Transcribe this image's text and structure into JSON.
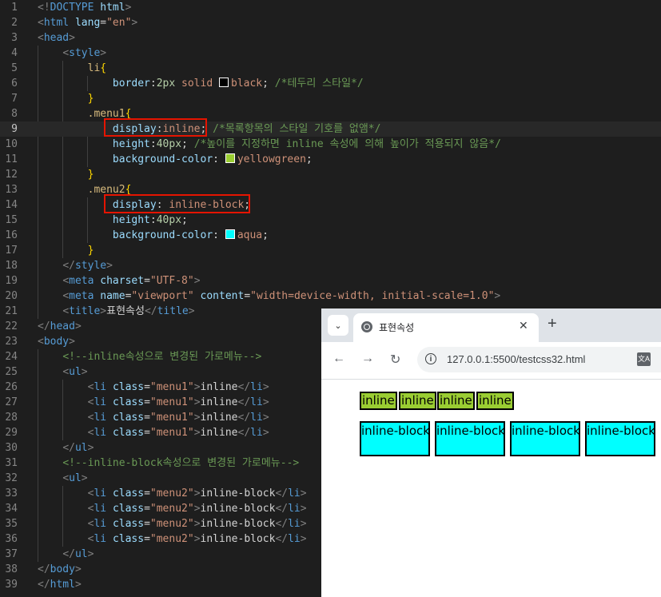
{
  "editor": {
    "lines": [
      {
        "n": "1",
        "segs": [
          [
            "t",
            "<!"
          ],
          [
            "tag",
            "DOCTYPE"
          ],
          [
            "txt",
            " "
          ],
          [
            "attr",
            "html"
          ],
          [
            "t",
            ">"
          ]
        ]
      },
      {
        "n": "2",
        "segs": [
          [
            "t",
            "<"
          ],
          [
            "tag",
            "html"
          ],
          [
            "txt",
            " "
          ],
          [
            "attr",
            "lang"
          ],
          [
            "txt",
            "="
          ],
          [
            "str",
            "\"en\""
          ],
          [
            "t",
            ">"
          ]
        ]
      },
      {
        "n": "3",
        "segs": [
          [
            "t",
            "<"
          ],
          [
            "tag",
            "head"
          ],
          [
            "t",
            ">"
          ]
        ]
      },
      {
        "n": "4",
        "segs": [
          [
            "txt",
            "    "
          ],
          [
            "t",
            "<"
          ],
          [
            "tag",
            "style"
          ],
          [
            "t",
            ">"
          ]
        ]
      },
      {
        "n": "5",
        "segs": [
          [
            "txt",
            "        "
          ],
          [
            "sel",
            "li"
          ],
          [
            "brace",
            "{"
          ]
        ]
      },
      {
        "n": "6",
        "segs": [
          [
            "txt",
            "            "
          ],
          [
            "prop",
            "border"
          ],
          [
            "txt",
            ":"
          ],
          [
            "num",
            "2px"
          ],
          [
            "txt",
            " "
          ],
          [
            "val",
            "solid"
          ],
          [
            "txt",
            " "
          ],
          [
            "swatch",
            "#000000"
          ],
          [
            "val",
            "black"
          ],
          [
            "txt",
            "; "
          ],
          [
            "cmt",
            "/*테두리 스타일*/"
          ]
        ]
      },
      {
        "n": "7",
        "segs": [
          [
            "txt",
            "        "
          ],
          [
            "brace",
            "}"
          ]
        ]
      },
      {
        "n": "8",
        "segs": [
          [
            "txt",
            "        "
          ],
          [
            "sel",
            ".menu1"
          ],
          [
            "brace",
            "{"
          ]
        ]
      },
      {
        "n": "9",
        "segs": [
          [
            "txt",
            "            "
          ],
          [
            "prop",
            "display"
          ],
          [
            "txt",
            ":"
          ],
          [
            "val",
            "inline"
          ],
          [
            "txt",
            "; "
          ],
          [
            "cmt",
            "/*목록항목의 스타일 기호를 없앰*/"
          ]
        ]
      },
      {
        "n": "10",
        "segs": [
          [
            "txt",
            "            "
          ],
          [
            "prop",
            "height"
          ],
          [
            "txt",
            ":"
          ],
          [
            "num",
            "40px"
          ],
          [
            "txt",
            "; "
          ],
          [
            "cmt",
            "/*높이를 지정하면 inline 속성에 의해 높이가 적용되지 않음*/"
          ]
        ]
      },
      {
        "n": "11",
        "segs": [
          [
            "txt",
            "            "
          ],
          [
            "prop",
            "background-color"
          ],
          [
            "txt",
            ": "
          ],
          [
            "swatch",
            "#9acd32"
          ],
          [
            "val",
            "yellowgreen"
          ],
          [
            "txt",
            ";"
          ]
        ]
      },
      {
        "n": "12",
        "segs": [
          [
            "txt",
            "        "
          ],
          [
            "brace",
            "}"
          ]
        ]
      },
      {
        "n": "13",
        "segs": [
          [
            "txt",
            "        "
          ],
          [
            "sel",
            ".menu2"
          ],
          [
            "brace",
            "{"
          ]
        ]
      },
      {
        "n": "14",
        "segs": [
          [
            "txt",
            "            "
          ],
          [
            "prop",
            "display"
          ],
          [
            "txt",
            ": "
          ],
          [
            "val",
            "inline-block"
          ],
          [
            "txt",
            ";"
          ]
        ]
      },
      {
        "n": "15",
        "segs": [
          [
            "txt",
            "            "
          ],
          [
            "prop",
            "height"
          ],
          [
            "txt",
            ":"
          ],
          [
            "num",
            "40px"
          ],
          [
            "txt",
            ";"
          ]
        ]
      },
      {
        "n": "16",
        "segs": [
          [
            "txt",
            "            "
          ],
          [
            "prop",
            "background-color"
          ],
          [
            "txt",
            ": "
          ],
          [
            "swatch",
            "#00ffff"
          ],
          [
            "val",
            "aqua"
          ],
          [
            "txt",
            ";"
          ]
        ]
      },
      {
        "n": "17",
        "segs": [
          [
            "txt",
            "        "
          ],
          [
            "brace",
            "}"
          ]
        ]
      },
      {
        "n": "18",
        "segs": [
          [
            "txt",
            "    "
          ],
          [
            "t",
            "</"
          ],
          [
            "tag",
            "style"
          ],
          [
            "t",
            ">"
          ]
        ]
      },
      {
        "n": "19",
        "segs": [
          [
            "txt",
            "    "
          ],
          [
            "t",
            "<"
          ],
          [
            "tag",
            "meta"
          ],
          [
            "txt",
            " "
          ],
          [
            "attr",
            "charset"
          ],
          [
            "txt",
            "="
          ],
          [
            "str",
            "\"UTF-8\""
          ],
          [
            "t",
            ">"
          ]
        ]
      },
      {
        "n": "20",
        "segs": [
          [
            "txt",
            "    "
          ],
          [
            "t",
            "<"
          ],
          [
            "tag",
            "meta"
          ],
          [
            "txt",
            " "
          ],
          [
            "attr",
            "name"
          ],
          [
            "txt",
            "="
          ],
          [
            "str",
            "\"viewport\""
          ],
          [
            "txt",
            " "
          ],
          [
            "attr",
            "content"
          ],
          [
            "txt",
            "="
          ],
          [
            "str",
            "\"width=device-width, initial-scale=1.0\""
          ],
          [
            "t",
            ">"
          ]
        ]
      },
      {
        "n": "21",
        "segs": [
          [
            "txt",
            "    "
          ],
          [
            "t",
            "<"
          ],
          [
            "tag",
            "title"
          ],
          [
            "t",
            ">"
          ],
          [
            "txt",
            "표현속성"
          ],
          [
            "t",
            "</"
          ],
          [
            "tag",
            "title"
          ],
          [
            "t",
            ">"
          ]
        ]
      },
      {
        "n": "22",
        "segs": [
          [
            "t",
            "</"
          ],
          [
            "tag",
            "head"
          ],
          [
            "t",
            ">"
          ]
        ]
      },
      {
        "n": "23",
        "segs": [
          [
            "t",
            "<"
          ],
          [
            "tag",
            "body"
          ],
          [
            "t",
            ">"
          ]
        ]
      },
      {
        "n": "24",
        "segs": [
          [
            "txt",
            "    "
          ],
          [
            "cmt",
            "<!--inline속성으로 변경된 가로메뉴-->"
          ]
        ]
      },
      {
        "n": "25",
        "segs": [
          [
            "txt",
            "    "
          ],
          [
            "t",
            "<"
          ],
          [
            "tag",
            "ul"
          ],
          [
            "t",
            ">"
          ]
        ]
      },
      {
        "n": "26",
        "segs": [
          [
            "txt",
            "        "
          ],
          [
            "t",
            "<"
          ],
          [
            "tag",
            "li"
          ],
          [
            "txt",
            " "
          ],
          [
            "attr",
            "class"
          ],
          [
            "txt",
            "="
          ],
          [
            "str",
            "\"menu1\""
          ],
          [
            "t",
            ">"
          ],
          [
            "txt",
            "inline"
          ],
          [
            "t",
            "</"
          ],
          [
            "tag",
            "li"
          ],
          [
            "t",
            ">"
          ]
        ]
      },
      {
        "n": "27",
        "segs": [
          [
            "txt",
            "        "
          ],
          [
            "t",
            "<"
          ],
          [
            "tag",
            "li"
          ],
          [
            "txt",
            " "
          ],
          [
            "attr",
            "class"
          ],
          [
            "txt",
            "="
          ],
          [
            "str",
            "\"menu1\""
          ],
          [
            "t",
            ">"
          ],
          [
            "txt",
            "inline"
          ],
          [
            "t",
            "</"
          ],
          [
            "tag",
            "li"
          ],
          [
            "t",
            ">"
          ]
        ]
      },
      {
        "n": "28",
        "segs": [
          [
            "txt",
            "        "
          ],
          [
            "t",
            "<"
          ],
          [
            "tag",
            "li"
          ],
          [
            "txt",
            " "
          ],
          [
            "attr",
            "class"
          ],
          [
            "txt",
            "="
          ],
          [
            "str",
            "\"menu1\""
          ],
          [
            "t",
            ">"
          ],
          [
            "txt",
            "inline"
          ],
          [
            "t",
            "</"
          ],
          [
            "tag",
            "li"
          ],
          [
            "t",
            ">"
          ]
        ]
      },
      {
        "n": "29",
        "segs": [
          [
            "txt",
            "        "
          ],
          [
            "t",
            "<"
          ],
          [
            "tag",
            "li"
          ],
          [
            "txt",
            " "
          ],
          [
            "attr",
            "class"
          ],
          [
            "txt",
            "="
          ],
          [
            "str",
            "\"menu1\""
          ],
          [
            "t",
            ">"
          ],
          [
            "txt",
            "inline"
          ],
          [
            "t",
            "</"
          ],
          [
            "tag",
            "li"
          ],
          [
            "t",
            ">"
          ]
        ]
      },
      {
        "n": "30",
        "segs": [
          [
            "txt",
            "    "
          ],
          [
            "t",
            "</"
          ],
          [
            "tag",
            "ul"
          ],
          [
            "t",
            ">"
          ]
        ]
      },
      {
        "n": "31",
        "segs": [
          [
            "txt",
            "    "
          ],
          [
            "cmt",
            "<!--inline-block속성으로 변경된 가로메뉴-->"
          ]
        ]
      },
      {
        "n": "32",
        "segs": [
          [
            "txt",
            "    "
          ],
          [
            "t",
            "<"
          ],
          [
            "tag",
            "ul"
          ],
          [
            "t",
            ">"
          ]
        ]
      },
      {
        "n": "33",
        "segs": [
          [
            "txt",
            "        "
          ],
          [
            "t",
            "<"
          ],
          [
            "tag",
            "li"
          ],
          [
            "txt",
            " "
          ],
          [
            "attr",
            "class"
          ],
          [
            "txt",
            "="
          ],
          [
            "str",
            "\"menu2\""
          ],
          [
            "t",
            ">"
          ],
          [
            "txt",
            "inline-block"
          ],
          [
            "t",
            "</"
          ],
          [
            "tag",
            "li"
          ],
          [
            "t",
            ">"
          ]
        ]
      },
      {
        "n": "34",
        "segs": [
          [
            "txt",
            "        "
          ],
          [
            "t",
            "<"
          ],
          [
            "tag",
            "li"
          ],
          [
            "txt",
            " "
          ],
          [
            "attr",
            "class"
          ],
          [
            "txt",
            "="
          ],
          [
            "str",
            "\"menu2\""
          ],
          [
            "t",
            ">"
          ],
          [
            "txt",
            "inline-block"
          ],
          [
            "t",
            "</"
          ],
          [
            "tag",
            "li"
          ],
          [
            "t",
            ">"
          ]
        ]
      },
      {
        "n": "35",
        "segs": [
          [
            "txt",
            "        "
          ],
          [
            "t",
            "<"
          ],
          [
            "tag",
            "li"
          ],
          [
            "txt",
            " "
          ],
          [
            "attr",
            "class"
          ],
          [
            "txt",
            "="
          ],
          [
            "str",
            "\"menu2\""
          ],
          [
            "t",
            ">"
          ],
          [
            "txt",
            "inline-block"
          ],
          [
            "t",
            "</"
          ],
          [
            "tag",
            "li"
          ],
          [
            "t",
            ">"
          ]
        ]
      },
      {
        "n": "36",
        "segs": [
          [
            "txt",
            "        "
          ],
          [
            "t",
            "<"
          ],
          [
            "tag",
            "li"
          ],
          [
            "txt",
            " "
          ],
          [
            "attr",
            "class"
          ],
          [
            "txt",
            "="
          ],
          [
            "str",
            "\"menu2\""
          ],
          [
            "t",
            ">"
          ],
          [
            "txt",
            "inline-block"
          ],
          [
            "t",
            "</"
          ],
          [
            "tag",
            "li"
          ],
          [
            "t",
            ">"
          ]
        ]
      },
      {
        "n": "37",
        "segs": [
          [
            "txt",
            "    "
          ],
          [
            "t",
            "</"
          ],
          [
            "tag",
            "ul"
          ],
          [
            "t",
            ">"
          ]
        ]
      },
      {
        "n": "38",
        "segs": [
          [
            "t",
            "</"
          ],
          [
            "tag",
            "body"
          ],
          [
            "t",
            ">"
          ]
        ]
      },
      {
        "n": "39",
        "segs": [
          [
            "t",
            "</"
          ],
          [
            "tag",
            "html"
          ],
          [
            "t",
            ">"
          ]
        ]
      }
    ],
    "current_line": "9",
    "highlight_color": "#e51400"
  },
  "browser": {
    "tab_title": "표현속성",
    "tab_close": "✕",
    "new_tab": "+",
    "url": "127.0.0.1:5500/testcss32.html",
    "translate_glyph": "文A",
    "info_glyph": "i",
    "menu_glyph": "⌄",
    "back_glyph": "←",
    "forward_glyph": "→",
    "reload_glyph": "↻",
    "menu1_items": [
      "inline",
      "inline",
      "inline",
      "inline"
    ],
    "menu2_items": [
      "inline-block",
      "inline-block",
      "inline-block",
      "inline-block"
    ],
    "menu1_color": "#9acd32",
    "menu2_color": "#00ffff"
  }
}
